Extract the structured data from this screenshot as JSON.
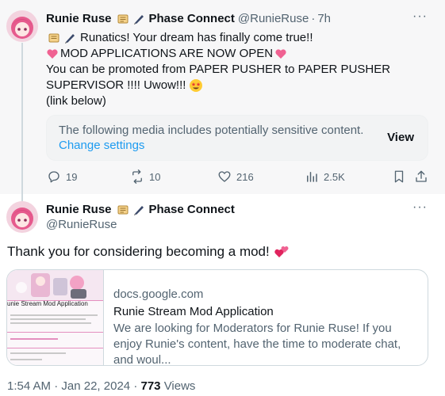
{
  "colors": {
    "accent": "#1d9bf0",
    "muted": "#536471",
    "text": "#0f1419",
    "heart": "#f06292"
  },
  "tweet1": {
    "author_name": "Runie Ruse",
    "affiliation": "Phase Connect",
    "handle": "@RunieRuse",
    "separator": "·",
    "time": "7h",
    "avatar_icon": "anime-avatar-icon",
    "lines": {
      "l1": "Runatics! Your dream has finally come true!!",
      "l2": "MOD APPLICATIONS ARE NOW OPEN",
      "l3": "You can be promoted from PAPER PUSHER to PAPER PUSHER",
      "l4": "SUPERVISOR !!!! Uwow!!!",
      "l5": "(link below)"
    },
    "sensitive": {
      "notice": "The following media includes potentially sensitive content.",
      "change_settings": "Change settings",
      "view": "View"
    },
    "stats": {
      "replies": "19",
      "reposts": "10",
      "likes": "216",
      "views": "2.5K"
    }
  },
  "tweet2": {
    "author_name": "Runie Ruse",
    "affiliation": "Phase Connect",
    "handle": "@RunieRuse",
    "text": "Thank you for considering becoming a mod!",
    "card": {
      "domain": "docs.google.com",
      "title": "Runie Stream Mod Application",
      "description": "We are looking for Moderators for Runie Ruse! If you enjoy Runie's content, have the time to moderate chat, and woul...",
      "thumb_title": "unie Stream Mod Application"
    },
    "meta": {
      "time": "1:54 AM",
      "sep1": "·",
      "date": "Jan 22, 2024",
      "sep2": "·",
      "views": "773",
      "views_label": "Views"
    }
  }
}
